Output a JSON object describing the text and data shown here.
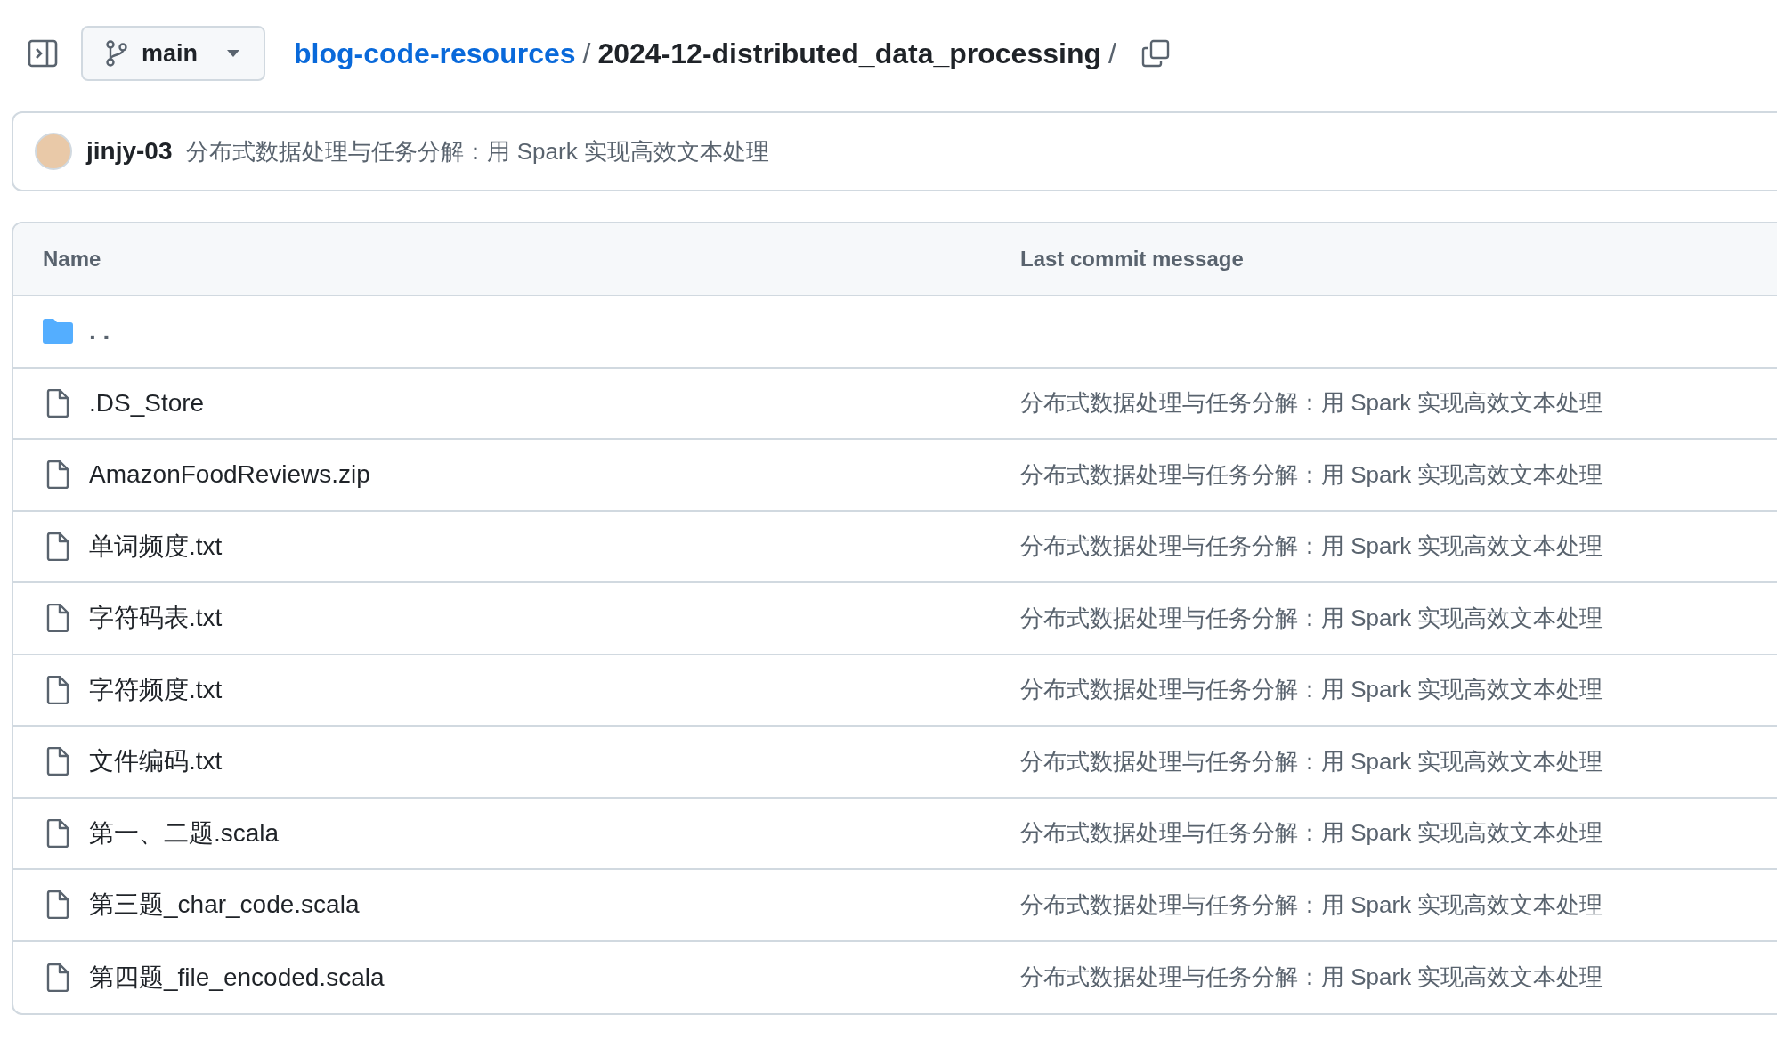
{
  "branch": {
    "label": "main"
  },
  "breadcrumb": {
    "repo": "blog-code-resources",
    "separator_1": "/",
    "folder": "2024-12-distributed_data_processing",
    "separator_2": "/"
  },
  "latest_commit": {
    "author": "jinjy-03",
    "message": "分布式数据处理与任务分解：用 Spark 实现高效文本处理"
  },
  "table": {
    "columns": [
      "Name",
      "Last commit message"
    ],
    "rows": [
      {
        "kind": "folder",
        "name": ". ."
      },
      {
        "kind": "file",
        "name": ".DS_Store",
        "message": "分布式数据处理与任务分解：用 Spark 实现高效文本处理"
      },
      {
        "kind": "file",
        "name": "AmazonFoodReviews.zip",
        "message": "分布式数据处理与任务分解：用 Spark 实现高效文本处理"
      },
      {
        "kind": "file",
        "name": "单词频度.txt",
        "message": "分布式数据处理与任务分解：用 Spark 实现高效文本处理"
      },
      {
        "kind": "file",
        "name": "字符码表.txt",
        "message": "分布式数据处理与任务分解：用 Spark 实现高效文本处理"
      },
      {
        "kind": "file",
        "name": "字符频度.txt",
        "message": "分布式数据处理与任务分解：用 Spark 实现高效文本处理"
      },
      {
        "kind": "file",
        "name": "文件编码.txt",
        "message": "分布式数据处理与任务分解：用 Spark 实现高效文本处理"
      },
      {
        "kind": "file",
        "name": "第一、二题.scala",
        "message": "分布式数据处理与任务分解：用 Spark 实现高效文本处理"
      },
      {
        "kind": "file",
        "name": "第三题_char_code.scala",
        "message": "分布式数据处理与任务分解：用 Spark 实现高效文本处理"
      },
      {
        "kind": "file",
        "name": "第四题_file_encoded.scala",
        "message": "分布式数据处理与任务分解：用 Spark 实现高效文本处理"
      }
    ]
  }
}
